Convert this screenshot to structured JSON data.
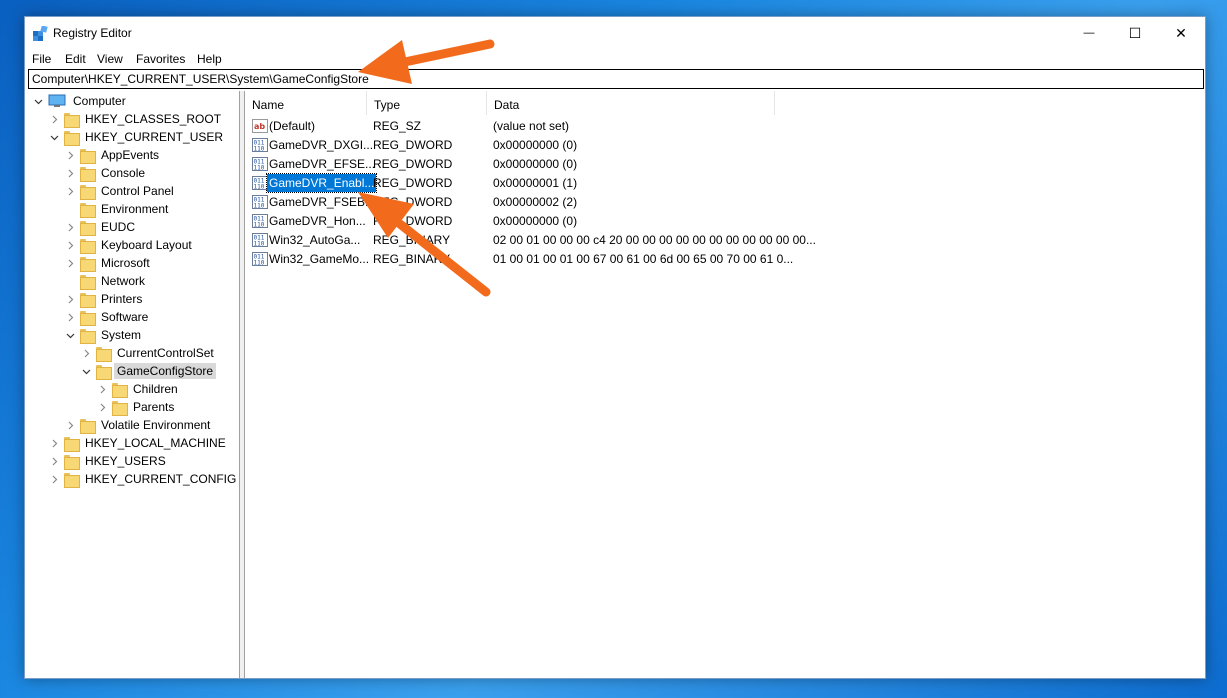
{
  "window": {
    "title": "Registry Editor",
    "minimize_glyph": "—",
    "maximize_glyph": "☐",
    "close_glyph": "✕"
  },
  "menu": [
    "File",
    "Edit",
    "View",
    "Favorites",
    "Help"
  ],
  "address": "Computer\\HKEY_CURRENT_USER\\System\\GameConfigStore",
  "tree": [
    {
      "label": "Computer",
      "level": 0,
      "expanded": true,
      "icon": "computer-icon"
    },
    {
      "label": "HKEY_CLASSES_ROOT",
      "level": 1,
      "expanded": false
    },
    {
      "label": "HKEY_CURRENT_USER",
      "level": 1,
      "expanded": true
    },
    {
      "label": "AppEvents",
      "level": 2,
      "expanded": false
    },
    {
      "label": "Console",
      "level": 2,
      "expanded": false
    },
    {
      "label": "Control Panel",
      "level": 2,
      "expanded": false
    },
    {
      "label": "Environment",
      "level": 2,
      "leaf": true
    },
    {
      "label": "EUDC",
      "level": 2,
      "expanded": false
    },
    {
      "label": "Keyboard Layout",
      "level": 2,
      "expanded": false
    },
    {
      "label": "Microsoft",
      "level": 2,
      "expanded": false
    },
    {
      "label": "Network",
      "level": 2,
      "leaf": true
    },
    {
      "label": "Printers",
      "level": 2,
      "expanded": false
    },
    {
      "label": "Software",
      "level": 2,
      "expanded": false
    },
    {
      "label": "System",
      "level": 2,
      "expanded": true
    },
    {
      "label": "CurrentControlSet",
      "level": 3,
      "expanded": false
    },
    {
      "label": "GameConfigStore",
      "level": 3,
      "expanded": true,
      "selected": true
    },
    {
      "label": "Children",
      "level": 4,
      "expanded": false
    },
    {
      "label": "Parents",
      "level": 4,
      "expanded": false
    },
    {
      "label": "Volatile Environment",
      "level": 2,
      "expanded": false
    },
    {
      "label": "HKEY_LOCAL_MACHINE",
      "level": 1,
      "expanded": false
    },
    {
      "label": "HKEY_USERS",
      "level": 1,
      "expanded": false
    },
    {
      "label": "HKEY_CURRENT_CONFIG",
      "level": 1,
      "expanded": false
    }
  ],
  "columns": {
    "name": "Name",
    "type": "Type",
    "data": "Data"
  },
  "values": [
    {
      "name": "(Default)",
      "type": "REG_SZ",
      "data": "(value not set)",
      "icon": "string-value-icon"
    },
    {
      "name": "GameDVR_DXGI...",
      "type": "REG_DWORD",
      "data": "0x00000000 (0)",
      "icon": "binary-value-icon"
    },
    {
      "name": "GameDVR_EFSE...",
      "type": "REG_DWORD",
      "data": "0x00000000 (0)",
      "icon": "binary-value-icon"
    },
    {
      "name": "GameDVR_Enabl...",
      "type": "REG_DWORD",
      "data": "0x00000001 (1)",
      "icon": "binary-value-icon",
      "selected": true
    },
    {
      "name": "GameDVR_FSEB...",
      "type": "REG_DWORD",
      "data": "0x00000002 (2)",
      "icon": "binary-value-icon"
    },
    {
      "name": "GameDVR_Hon...",
      "type": "REG_DWORD",
      "data": "0x00000000 (0)",
      "icon": "binary-value-icon"
    },
    {
      "name": "Win32_AutoGa...",
      "type": "REG_BINARY",
      "data": "02 00 01 00 00 00 c4 20 00 00 00 00 00 00 00 00 00 00 00...",
      "icon": "binary-value-icon"
    },
    {
      "name": "Win32_GameMo...",
      "type": "REG_BINARY",
      "data": "01 00 01 00 01 00 67 00 61 00 6d 00 65 00 70 00 61 0...",
      "icon": "binary-value-icon"
    }
  ],
  "colors": {
    "accent": "#0078d7",
    "annotation": "#f26b1d"
  }
}
